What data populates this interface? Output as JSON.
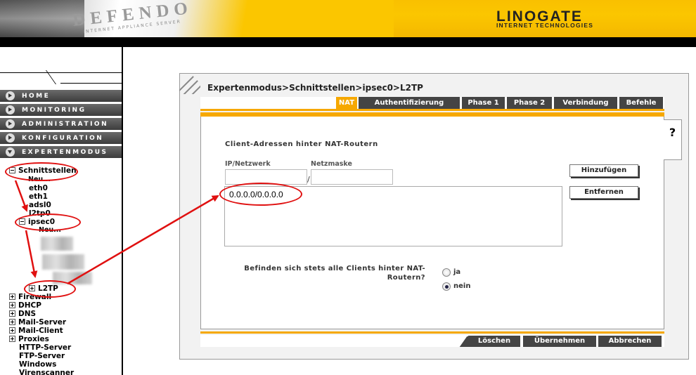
{
  "header": {
    "brand_left": "DEFENDO",
    "brand_left_sub": "INTERNET APPLIANCE SERVER",
    "brand_right": "LINOGATE",
    "brand_right_sub": "INTERNET TECHNOLOGIES"
  },
  "nav": {
    "items": [
      {
        "label": "HOME",
        "icon": "arrow-right-icon"
      },
      {
        "label": "MONITORING",
        "icon": "arrow-right-icon"
      },
      {
        "label": "ADMINISTRATION",
        "icon": "arrow-right-icon"
      },
      {
        "label": "KONFIGURATION",
        "icon": "arrow-right-icon"
      },
      {
        "label": "EXPERTENMODUS",
        "icon": "arrow-down-icon"
      }
    ]
  },
  "tree": {
    "schnittstellen": "Schnittstellen",
    "neu1": "Neu...",
    "eth0": "eth0",
    "eth1": "eth1",
    "adsl0": "adsl0",
    "l2tp0": "l2tp0",
    "ipsec0": "ipsec0",
    "neu2": "Neu...",
    "l2tp": "L2TP",
    "firewall": "Firewall",
    "dhcp": "DHCP",
    "dns": "DNS",
    "mail_server": "Mail-Server",
    "mail_client": "Mail-Client",
    "proxies": "Proxies",
    "http_server": "HTTP-Server",
    "ftp_server": "FTP-Server",
    "windows": "Windows",
    "virenscanner": "Virenscanner"
  },
  "breadcrumb": "Expertenmodus>Schnittstellen>ipsec0>L2TP",
  "tabs": [
    {
      "label": "NAT",
      "active": true
    },
    {
      "label": "Authentifizierung",
      "active": false
    },
    {
      "label": "Phase 1",
      "active": false
    },
    {
      "label": "Phase 2",
      "active": false
    },
    {
      "label": "Verbindung",
      "active": false
    },
    {
      "label": "Befehle",
      "active": false
    }
  ],
  "help_label": "?",
  "form": {
    "section_title": "Client-Adressen hinter NAT-Routern",
    "ip_label": "IP/Netzwerk",
    "mask_label": "Netzmaske",
    "ip_value": "",
    "mask_value": "",
    "separator": "/",
    "list_items": [
      "0.0.0.0/0.0.0.0"
    ],
    "add_button": "Hinzufügen",
    "remove_button": "Entfernen",
    "question_line1": "Befinden sich stets alle Clients hinter NAT-",
    "question_line2": "Routern?",
    "radio_yes": "ja",
    "radio_no": "nein",
    "selected": "nein"
  },
  "footer_buttons": {
    "delete": "Löschen",
    "apply": "Übernehmen",
    "cancel": "Abbrechen"
  },
  "colors": {
    "accent": "#f6a800",
    "header_yellow": "#fbc600",
    "nav_dark": "#444444",
    "annotation_red": "#e01010"
  }
}
